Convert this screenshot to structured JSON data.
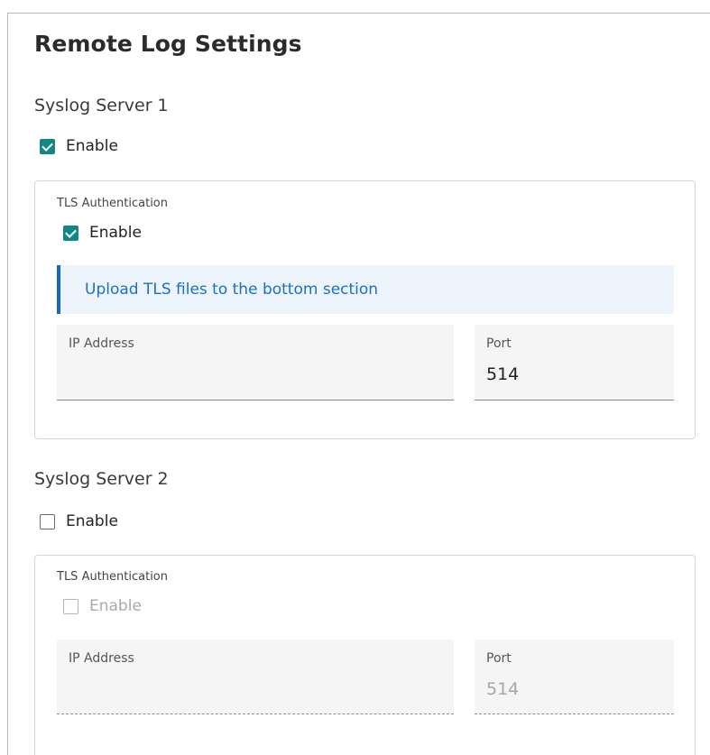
{
  "title": "Remote Log Settings",
  "servers": [
    {
      "heading": "Syslog Server 1",
      "enable_label": "Enable",
      "enabled": true,
      "tls": {
        "label": "TLS Authentication",
        "enable_label": "Enable",
        "enabled": true
      },
      "notice": "Upload TLS files to the bottom section",
      "ip": {
        "label": "IP Address",
        "value": ""
      },
      "port": {
        "label": "Port",
        "value": "514"
      }
    },
    {
      "heading": "Syslog Server 2",
      "enable_label": "Enable",
      "enabled": false,
      "tls": {
        "label": "TLS Authentication",
        "enable_label": "Enable",
        "enabled": false,
        "disabled": true
      },
      "ip": {
        "label": "IP Address",
        "value": ""
      },
      "port": {
        "label": "Port",
        "value": "514"
      }
    }
  ],
  "colors": {
    "accent": "#138786",
    "notice_border": "#1766c3",
    "notice_text": "#1a6fc8",
    "notice_bg": "#eef4fb"
  }
}
